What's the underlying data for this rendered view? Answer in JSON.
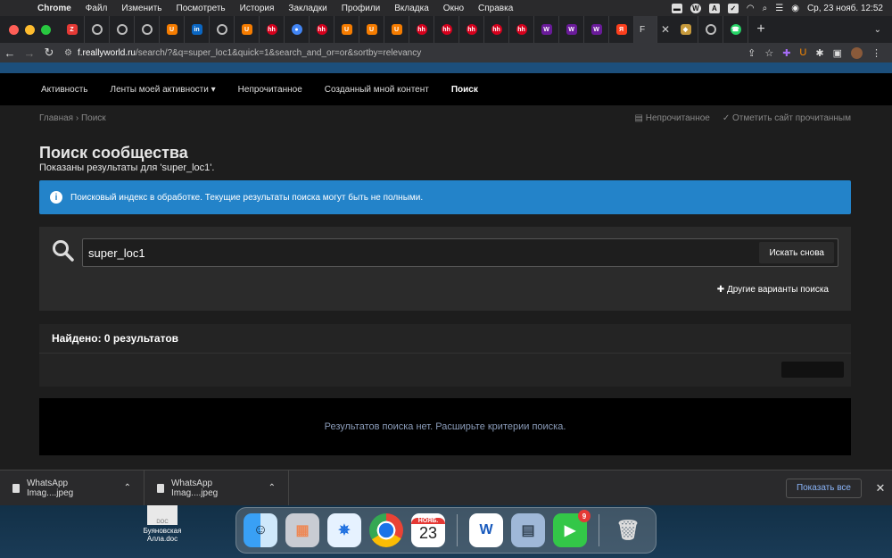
{
  "menubar": {
    "app": "Chrome",
    "items": [
      "Файл",
      "Изменить",
      "Посмотреть",
      "История",
      "Закладки",
      "Профили",
      "Вкладка",
      "Окно",
      "Справка"
    ],
    "datetime": "Ср, 23 нояб.  12:52"
  },
  "tabs": {
    "favicons": [
      "Z",
      "⊙",
      "⊙",
      "⊙",
      "U",
      "in",
      "⊙",
      "U",
      "hh",
      "●",
      "hh",
      "U",
      "U",
      "U",
      "hh",
      "hh",
      "hh",
      "hh",
      "hh",
      "W",
      "W",
      "W",
      "Я"
    ],
    "active_label": "F",
    "after": [
      "◆",
      "⊙",
      "☎"
    ]
  },
  "address": {
    "host": "f.reallyworld.ru",
    "path": "/search/?&q=super_loc1&quick=1&search_and_or=or&sortby=relevancy"
  },
  "nav": {
    "items": [
      "Активность",
      "Ленты моей активности ▾",
      "Непрочитанное",
      "Созданный мной контент",
      "Поиск"
    ]
  },
  "breadcrumb": {
    "home": "Главная",
    "sep": "›",
    "current": "Поиск"
  },
  "crumb_actions": {
    "unread": "Непрочитанное",
    "mark_read": "Отметить сайт прочитанным"
  },
  "page": {
    "title": "Поиск сообщества",
    "subtitle": "Показаны результаты для 'super_loc1'."
  },
  "notice": {
    "text": "Поисковый индекс в обработке. Текущие результаты поиска могут быть не полными."
  },
  "search": {
    "value": "super_loc1",
    "button": "Искать снова",
    "more": "Другие варианты поиска"
  },
  "results": {
    "header": "Найдено: 0 результатов",
    "empty": "Результатов поиска нет. Расширьте критерии поиска."
  },
  "downloads": {
    "items": [
      "WhatsApp Imag....jpeg",
      "WhatsApp Imag....jpeg"
    ],
    "show_all": "Показать все"
  },
  "desktop": {
    "file_thumb": "DOC",
    "file_name": "Буяновская Алла.doc"
  },
  "dock": {
    "calendar_month": "НОЯБ.",
    "calendar_day": "23",
    "facetime_badge": "9"
  }
}
